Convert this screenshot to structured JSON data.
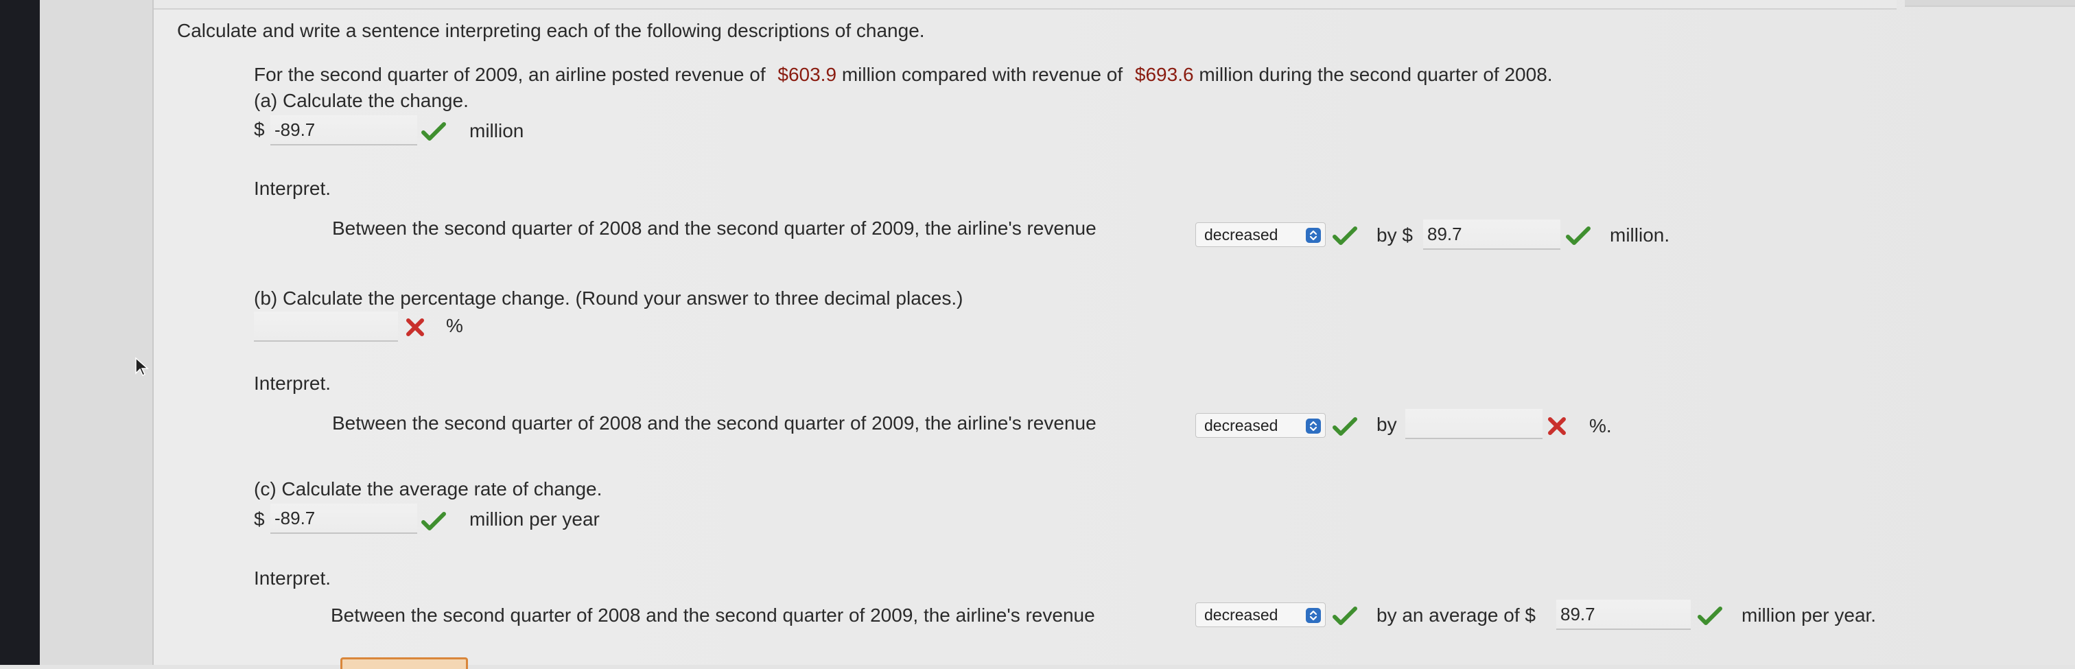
{
  "instructions": "Calculate and write a sentence interpreting each of the following descriptions of change.",
  "problem": {
    "prefix": "For the second quarter of 2009, an airline posted revenue of",
    "value1": "$603.9",
    "mid": "million  compared with revenue of",
    "value2": "$693.6",
    "suffix": "million  during the second quarter of 2008."
  },
  "part_a": {
    "heading": "(a) Calculate the change.",
    "currency": "$",
    "answer": "-89.7",
    "unit": "million",
    "interpret_label": "Interpret.",
    "sentence": "Between the second quarter of 2008 and the second quarter of 2009, the airline's revenue",
    "dropdown": "decreased",
    "by_label": "by $",
    "by_value": "89.7",
    "end": "million."
  },
  "part_b": {
    "heading": "(b) Calculate the percentage change. (Round your answer to three decimal places.)",
    "answer": "",
    "unit": "%",
    "interpret_label": "Interpret.",
    "sentence": "Between the second quarter of 2008 and the second quarter of 2009, the airline's revenue",
    "dropdown": "decreased",
    "by_label": "by",
    "by_value": "",
    "end": "%."
  },
  "part_c": {
    "heading": "(c) Calculate the average rate of change.",
    "currency": "$",
    "answer": "-89.7",
    "unit": "million per year",
    "interpret_label": "Interpret.",
    "sentence": "Between the second quarter of 2008 and the second quarter of 2009, the airline's revenue",
    "dropdown": "decreased",
    "by_label": "by an average of $",
    "by_value": "89.7",
    "end": "million per year."
  },
  "colors": {
    "correct": "#3f8f2f",
    "incorrect": "#c9302c",
    "highlight": "#8a1c10",
    "select_icon": "#2e6fc2"
  }
}
